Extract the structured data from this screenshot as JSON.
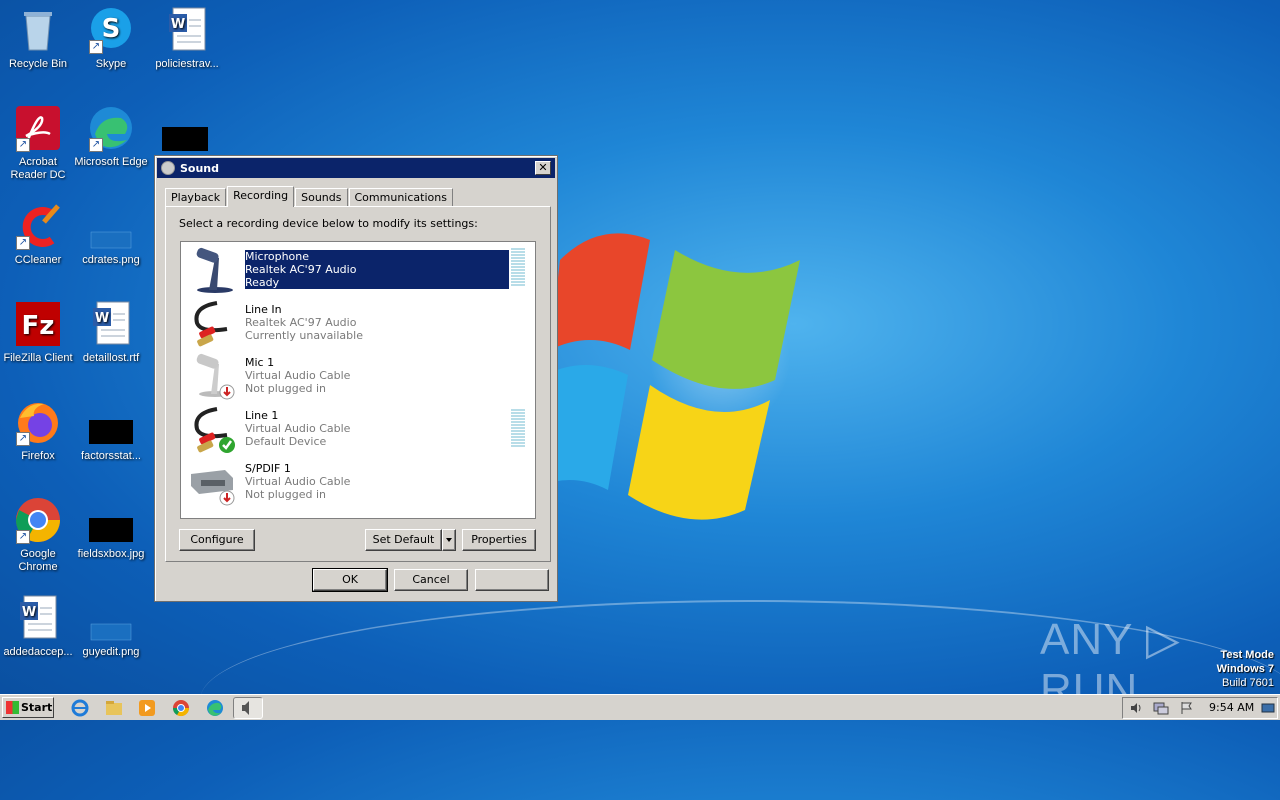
{
  "desktop": {
    "icons": [
      {
        "label": "Recycle Bin",
        "icon": "recycle-bin-icon"
      },
      {
        "label": "Skype",
        "icon": "skype-icon"
      },
      {
        "label": "policiestrav...",
        "icon": "word-doc-icon"
      },
      {
        "label": "Acrobat Reader DC",
        "icon": "acrobat-icon"
      },
      {
        "label": "Microsoft Edge",
        "icon": "edge-icon"
      },
      {
        "label": "CCleaner",
        "icon": "ccleaner-icon"
      },
      {
        "label": "cdrates.png",
        "icon": "image-icon"
      },
      {
        "label": "FileZilla Client",
        "icon": "filezilla-icon"
      },
      {
        "label": "detaillost.rtf",
        "icon": "word-doc-icon"
      },
      {
        "label": "Firefox",
        "icon": "firefox-icon"
      },
      {
        "label": "factorsstat...",
        "icon": "black-thumbnail"
      },
      {
        "label": "Google Chrome",
        "icon": "chrome-icon"
      },
      {
        "label": "fieldsxbox.jpg",
        "icon": "black-thumbnail"
      },
      {
        "label": "addedaccep...",
        "icon": "word-doc-icon"
      },
      {
        "label": "guyedit.png",
        "icon": "image-icon"
      }
    ]
  },
  "dialog": {
    "title": "Sound",
    "close_label": "✕",
    "tabs": [
      "Playback",
      "Recording",
      "Sounds",
      "Communications"
    ],
    "active_tab": "Recording",
    "instruction": "Select a recording device below to modify its settings:",
    "devices": [
      {
        "name": "Microphone",
        "driver": "Realtek AC'97 Audio",
        "status": "Ready",
        "selected": true,
        "icon": "microphone-icon"
      },
      {
        "name": "Line In",
        "driver": "Realtek AC'97 Audio",
        "status": "Currently unavailable",
        "selected": false,
        "icon": "line-in-cable-icon"
      },
      {
        "name": "Mic 1",
        "driver": "Virtual Audio Cable",
        "status": "Not plugged in",
        "selected": false,
        "icon": "microphone-icon"
      },
      {
        "name": "Line 1",
        "driver": "Virtual Audio Cable",
        "status": "Default Device",
        "selected": false,
        "icon": "line-in-cable-icon"
      },
      {
        "name": "S/PDIF 1",
        "driver": "Virtual Audio Cable",
        "status": "Not plugged in",
        "selected": false,
        "icon": "spdif-device-icon"
      }
    ],
    "buttons": {
      "configure": "Configure",
      "set_default": "Set Default",
      "properties": "Properties",
      "ok": "OK",
      "cancel": "Cancel",
      "apply": ""
    }
  },
  "taskbar": {
    "start_label": "Start",
    "clock": "9:54 AM",
    "pinned": [
      "internet-explorer-icon",
      "explorer-icon",
      "media-player-icon",
      "chrome-icon",
      "edge-icon",
      "sound-icon"
    ]
  },
  "overlay": {
    "watermark": "ANY ▷ RUN",
    "test_mode_line1": "Test Mode",
    "test_mode_line2": "Windows 7",
    "test_mode_line3": "Build 7601"
  }
}
